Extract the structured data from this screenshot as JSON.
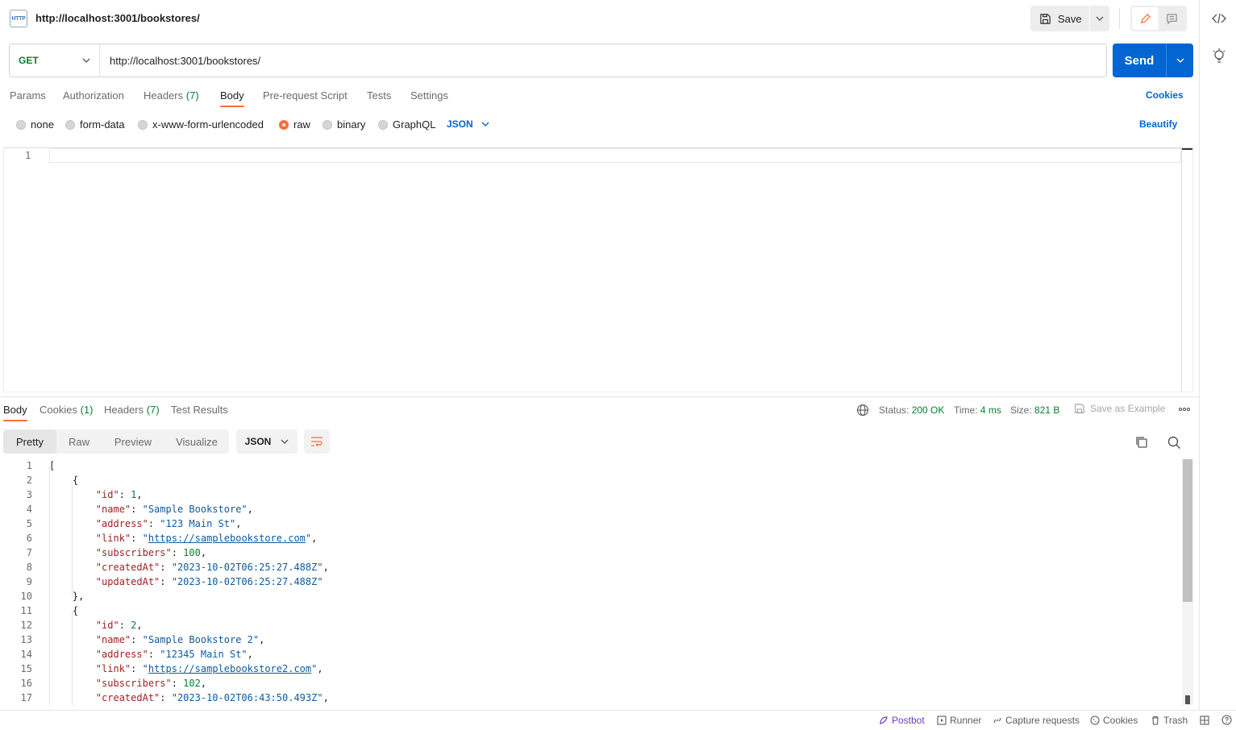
{
  "header": {
    "icon_text": "HTTP",
    "tab_title": "http://localhost:3001/bookstores/",
    "save_label": "Save"
  },
  "request": {
    "method": "GET",
    "url": "http://localhost:3001/bookstores/",
    "send_label": "Send",
    "tabs": {
      "params": "Params",
      "authorization": "Authorization",
      "headers": "Headers",
      "headers_count": "(7)",
      "body": "Body",
      "prerequest": "Pre-request Script",
      "tests": "Tests",
      "settings": "Settings"
    },
    "cookies_label": "Cookies",
    "body_types": {
      "none": "none",
      "form_data": "form-data",
      "urlencoded": "x-www-form-urlencoded",
      "raw": "raw",
      "binary": "binary",
      "graphql": "GraphQL"
    },
    "selected_body_type": "raw",
    "raw_format": "JSON",
    "beautify_label": "Beautify",
    "editor_line": "1"
  },
  "response": {
    "tabs": {
      "body": "Body",
      "cookies": "Cookies",
      "cookies_count": "(1)",
      "headers": "Headers",
      "headers_count": "(7)",
      "test_results": "Test Results"
    },
    "status_label": "Status:",
    "status_value": "200 OK",
    "time_label": "Time:",
    "time_value": "4 ms",
    "size_label": "Size:",
    "size_value": "821 B",
    "save_example_label": "Save as Example",
    "view_modes": [
      "Pretty",
      "Raw",
      "Preview",
      "Visualize"
    ],
    "format": "JSON",
    "lines": [
      {
        "n": "1",
        "segments": [
          [
            "p",
            "["
          ]
        ]
      },
      {
        "n": "2",
        "segments": [
          [
            "p",
            "    {"
          ]
        ]
      },
      {
        "n": "3",
        "segments": [
          [
            "p",
            "        "
          ],
          [
            "k",
            "\"id\""
          ],
          [
            "p",
            ": "
          ],
          [
            "n",
            "1"
          ],
          [
            "p",
            ","
          ]
        ]
      },
      {
        "n": "4",
        "segments": [
          [
            "p",
            "        "
          ],
          [
            "k",
            "\"name\""
          ],
          [
            "p",
            ": "
          ],
          [
            "s",
            "\"Sample Bookstore\""
          ],
          [
            "p",
            ","
          ]
        ]
      },
      {
        "n": "5",
        "segments": [
          [
            "p",
            "        "
          ],
          [
            "k",
            "\"address\""
          ],
          [
            "p",
            ": "
          ],
          [
            "s",
            "\"123 Main St\""
          ],
          [
            "p",
            ","
          ]
        ]
      },
      {
        "n": "6",
        "segments": [
          [
            "p",
            "        "
          ],
          [
            "k",
            "\"link\""
          ],
          [
            "p",
            ": "
          ],
          [
            "s",
            "\""
          ],
          [
            "u",
            "https://samplebookstore.com"
          ],
          [
            "s",
            "\""
          ],
          [
            "p",
            ","
          ]
        ]
      },
      {
        "n": "7",
        "segments": [
          [
            "p",
            "        "
          ],
          [
            "k",
            "\"subscribers\""
          ],
          [
            "p",
            ": "
          ],
          [
            "n",
            "100"
          ],
          [
            "p",
            ","
          ]
        ]
      },
      {
        "n": "8",
        "segments": [
          [
            "p",
            "        "
          ],
          [
            "k",
            "\"createdAt\""
          ],
          [
            "p",
            ": "
          ],
          [
            "s",
            "\"2023-10-02T06:25:27.488Z\""
          ],
          [
            "p",
            ","
          ]
        ]
      },
      {
        "n": "9",
        "segments": [
          [
            "p",
            "        "
          ],
          [
            "k",
            "\"updatedAt\""
          ],
          [
            "p",
            ": "
          ],
          [
            "s",
            "\"2023-10-02T06:25:27.488Z\""
          ]
        ]
      },
      {
        "n": "10",
        "segments": [
          [
            "p",
            "    },"
          ]
        ]
      },
      {
        "n": "11",
        "segments": [
          [
            "p",
            "    {"
          ]
        ]
      },
      {
        "n": "12",
        "segments": [
          [
            "p",
            "        "
          ],
          [
            "k",
            "\"id\""
          ],
          [
            "p",
            ": "
          ],
          [
            "n",
            "2"
          ],
          [
            "p",
            ","
          ]
        ]
      },
      {
        "n": "13",
        "segments": [
          [
            "p",
            "        "
          ],
          [
            "k",
            "\"name\""
          ],
          [
            "p",
            ": "
          ],
          [
            "s",
            "\"Sample Bookstore 2\""
          ],
          [
            "p",
            ","
          ]
        ]
      },
      {
        "n": "14",
        "segments": [
          [
            "p",
            "        "
          ],
          [
            "k",
            "\"address\""
          ],
          [
            "p",
            ": "
          ],
          [
            "s",
            "\"12345 Main St\""
          ],
          [
            "p",
            ","
          ]
        ]
      },
      {
        "n": "15",
        "segments": [
          [
            "p",
            "        "
          ],
          [
            "k",
            "\"link\""
          ],
          [
            "p",
            ": "
          ],
          [
            "s",
            "\""
          ],
          [
            "u",
            "https://samplebookstore2.com"
          ],
          [
            "s",
            "\""
          ],
          [
            "p",
            ","
          ]
        ]
      },
      {
        "n": "16",
        "segments": [
          [
            "p",
            "        "
          ],
          [
            "k",
            "\"subscribers\""
          ],
          [
            "p",
            ": "
          ],
          [
            "n",
            "102"
          ],
          [
            "p",
            ","
          ]
        ]
      },
      {
        "n": "17",
        "segments": [
          [
            "p",
            "        "
          ],
          [
            "k",
            "\"createdAt\""
          ],
          [
            "p",
            ": "
          ],
          [
            "s",
            "\"2023-10-02T06:43:50.493Z\""
          ],
          [
            "p",
            ","
          ]
        ]
      }
    ]
  },
  "footer": {
    "postbot": "Postbot",
    "runner": "Runner",
    "capture": "Capture requests",
    "cookies": "Cookies",
    "trash": "Trash"
  },
  "colors": {
    "accent": "#ff6c37",
    "primary": "#0265d2",
    "success": "#0a7d33",
    "key": "#9e2121",
    "string": "#0e5ba1"
  }
}
